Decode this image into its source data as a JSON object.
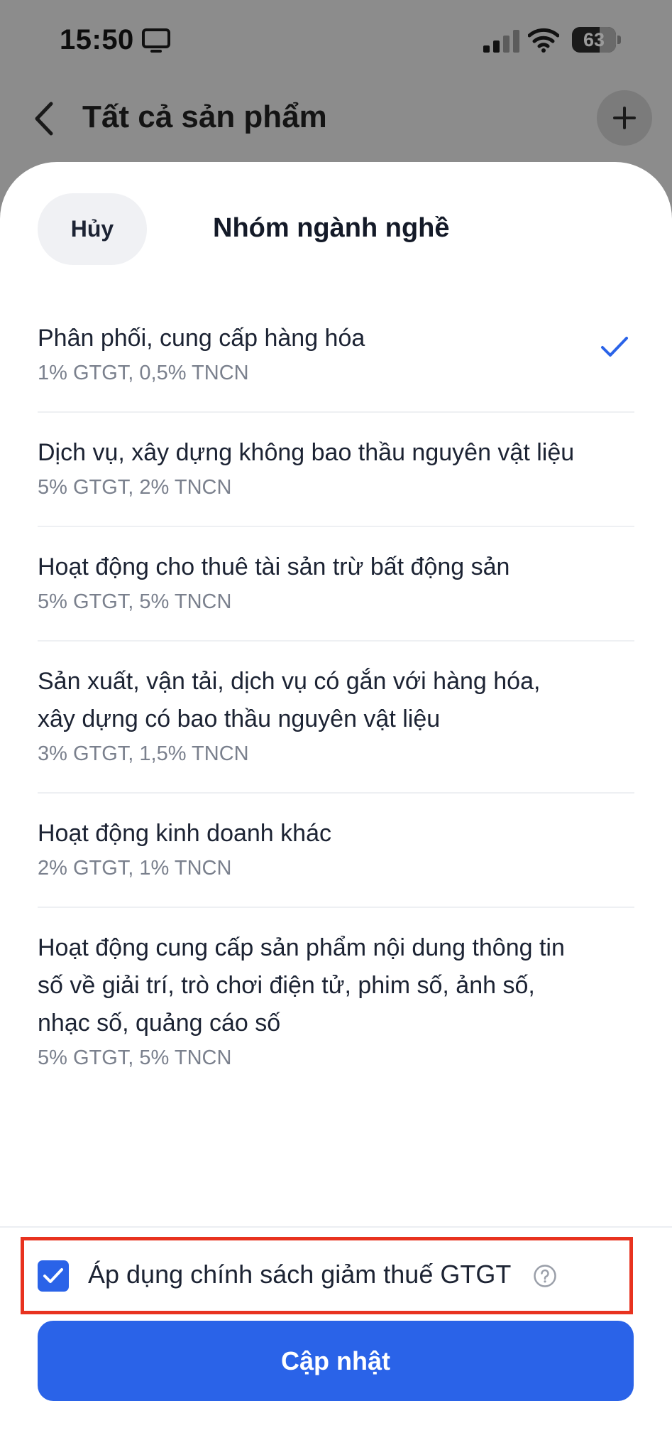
{
  "status_bar": {
    "time": "15:50",
    "battery_level": "63",
    "battery_fraction": 0.63,
    "icons": [
      "monitor-icon",
      "signal-icon",
      "wifi-icon",
      "battery-icon"
    ]
  },
  "nav": {
    "title": "Tất cả sản phẩm",
    "icons": [
      "back-icon",
      "add-icon"
    ]
  },
  "sheet": {
    "title": "Nhóm ngành nghề",
    "cancel_label": "Hủy",
    "options": [
      {
        "name": "Phân phối, cung cấp hàng hóa",
        "rate": "1% GTGT, 0,5% TNCN",
        "selected": true
      },
      {
        "name": "Dịch vụ, xây dựng không bao thầu nguyên vật liệu",
        "rate": "5% GTGT, 2% TNCN",
        "selected": false
      },
      {
        "name": "Hoạt động cho thuê tài sản trừ bất động sản",
        "rate": "5% GTGT, 5% TNCN",
        "selected": false
      },
      {
        "name": "Sản xuất, vận tải, dịch vụ có gắn với hàng hóa, xây dựng có bao thầu nguyên vật liệu",
        "rate": "3% GTGT, 1,5% TNCN",
        "selected": false
      },
      {
        "name": "Hoạt động kinh doanh khác",
        "rate": "2% GTGT, 1% TNCN",
        "selected": false
      },
      {
        "name": "Hoạt động cung cấp sản phẩm nội dung thông tin số về giải trí, trò chơi điện tử, phim số, ảnh số, nhạc số, quảng cáo số",
        "rate": "5% GTGT, 5% TNCN",
        "selected": false
      }
    ],
    "vat_policy": {
      "label": "Áp dụng chính sách giảm thuế GTGT",
      "checked": true
    },
    "update_label": "Cập nhật"
  },
  "colors": {
    "accent": "#2a63e8",
    "highlight": "#e8321f",
    "overlay": "#8c8c8c"
  }
}
